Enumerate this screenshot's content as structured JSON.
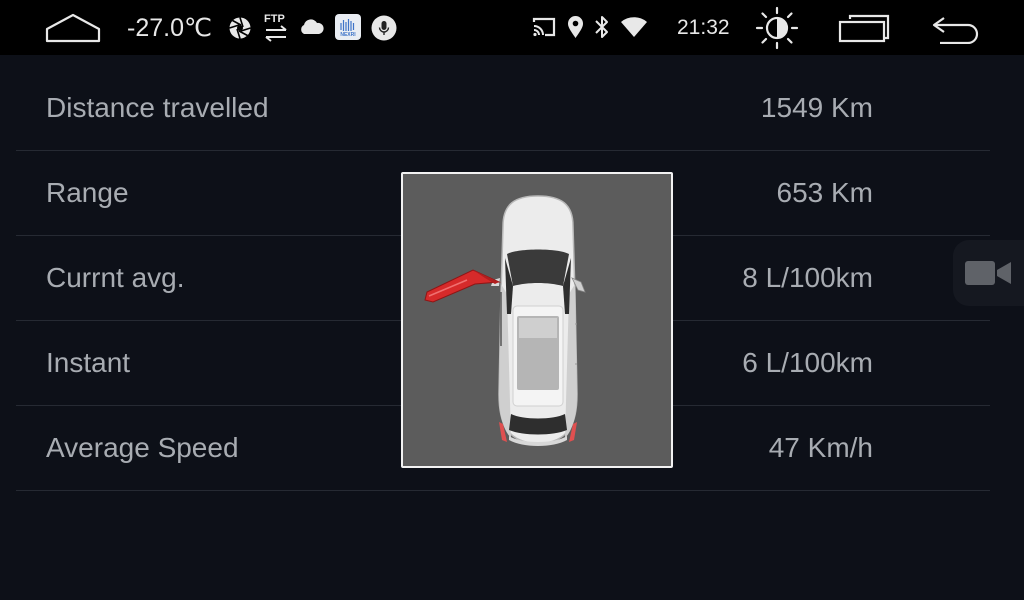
{
  "status_bar": {
    "temperature": "-27.0℃",
    "time": "21:32",
    "icons": [
      "home-icon",
      "aperture-icon",
      "ftp-transfer-icon",
      "cloud-icon",
      "nexri-app-icon",
      "microphone-icon",
      "cast-icon",
      "location-pin-icon",
      "bluetooth-icon",
      "wifi-icon",
      "brightness-icon",
      "recent-apps-icon",
      "back-icon"
    ],
    "nexri_label": "NEXRI",
    "ftp_label": "FTP"
  },
  "trip_info": {
    "rows": [
      {
        "label": "Distance travelled",
        "value": "1549 Km"
      },
      {
        "label": "Range",
        "value": "653 Km"
      },
      {
        "label": "Currnt avg.",
        "value": "8 L/100km"
      },
      {
        "label": "Instant",
        "value": "6 L/100km"
      },
      {
        "label": "Average Speed",
        "value": "47 Km/h"
      }
    ]
  },
  "door_status": {
    "open_door": "front-left",
    "highlight_color": "#d62a2a"
  },
  "side_tab": {
    "icon": "video-camera-icon"
  }
}
